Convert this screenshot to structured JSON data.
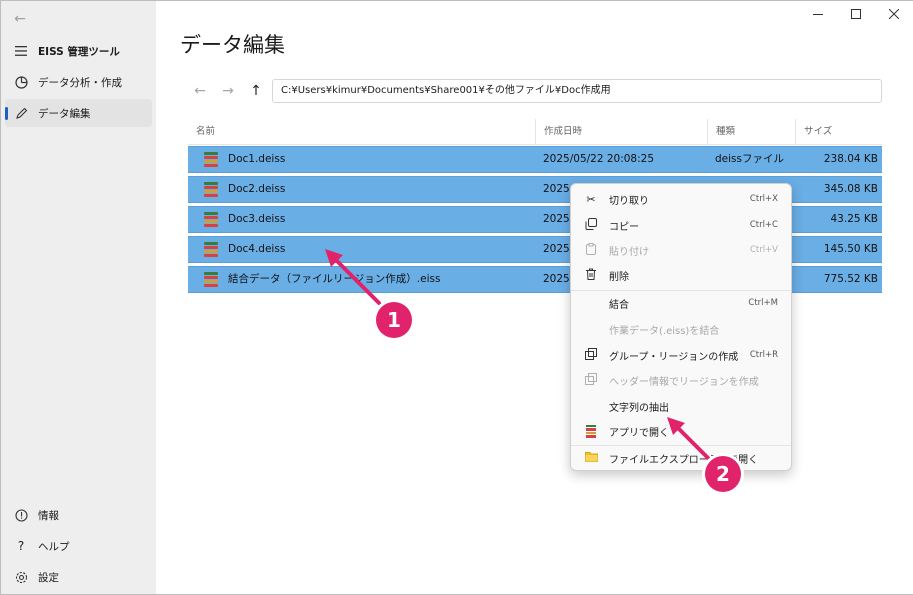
{
  "sidebar": {
    "back_glyph": "←",
    "title": "EISS 管理ツール",
    "items": [
      {
        "label": "データ分析・作成",
        "icon": "chart-pie-icon"
      },
      {
        "label": "データ編集",
        "icon": "edit-icon",
        "selected": true
      }
    ],
    "footer": [
      {
        "label": "情報",
        "icon": "info-icon"
      },
      {
        "label": "ヘルプ",
        "icon": "help-icon"
      },
      {
        "label": "設定",
        "icon": "settings-icon"
      }
    ]
  },
  "page": {
    "title": "データ編集",
    "path": "C:¥Users¥kimur¥Documents¥Share001¥その他ファイル¥Doc作成用"
  },
  "table": {
    "headers": [
      "名前",
      "作成日時",
      "種類",
      "サイズ"
    ],
    "rows": [
      {
        "name": "Doc1.deiss",
        "date": "2025/05/22 20:08:25",
        "type": "deissファイル",
        "size": "238.04 KB"
      },
      {
        "name": "Doc2.deiss",
        "date": "2025",
        "type": "",
        "size": "345.08 KB"
      },
      {
        "name": "Doc3.deiss",
        "date": "2025",
        "type": "",
        "size": "43.25 KB"
      },
      {
        "name": "Doc4.deiss",
        "date": "2025",
        "type": "",
        "size": "145.50 KB"
      },
      {
        "name": "結合データ（ファイルリージョン作成）.eiss",
        "date": "2025",
        "type": "",
        "size": "775.52 KB"
      }
    ]
  },
  "context_menu": {
    "items": [
      {
        "label": "切り取り",
        "shortcut": "Ctrl+X",
        "icon": "cut-icon",
        "disabled": false
      },
      {
        "label": "コピー",
        "shortcut": "Ctrl+C",
        "icon": "copy-icon",
        "disabled": false
      },
      {
        "label": "貼り付け",
        "shortcut": "Ctrl+V",
        "icon": "paste-icon",
        "disabled": true
      },
      {
        "label": "削除",
        "shortcut": "",
        "icon": "delete-icon",
        "disabled": false
      },
      {
        "label": "結合",
        "shortcut": "Ctrl+M",
        "icon": "",
        "disabled": false
      },
      {
        "label": "作業データ(.eiss)を結合",
        "shortcut": "",
        "icon": "",
        "disabled": true
      },
      {
        "label": "グループ・リージョンの作成",
        "shortcut": "Ctrl+R",
        "icon": "group-icon",
        "disabled": false
      },
      {
        "label": "ヘッダー情報でリージョンを作成",
        "shortcut": "",
        "icon": "group-icon",
        "disabled": true
      },
      {
        "label": "文字列の抽出",
        "shortcut": "",
        "icon": "",
        "disabled": false
      },
      {
        "label": "アプリで開く",
        "shortcut": "",
        "icon": "app-icon",
        "disabled": false
      },
      {
        "label": "ファイルエクスプローラーで開く",
        "shortcut": "",
        "icon": "folder-icon",
        "disabled": false
      }
    ]
  },
  "annotations": {
    "badge1": "1",
    "badge2": "2"
  },
  "colors": {
    "selection": "#6aaee6",
    "accent": "#1f5fbf",
    "badge": "#e0236a"
  }
}
